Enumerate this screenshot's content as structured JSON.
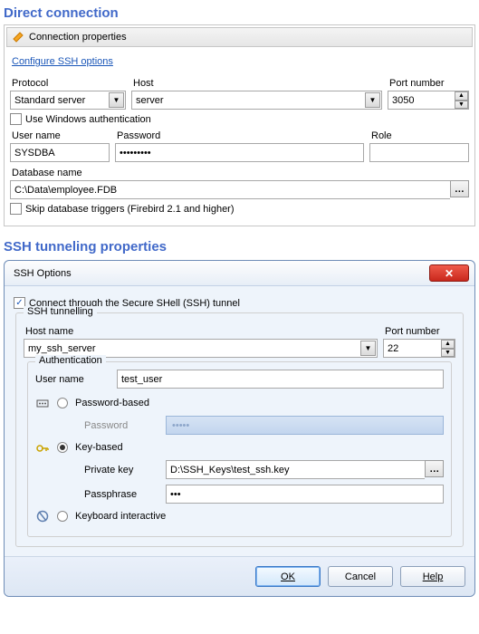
{
  "direct": {
    "title": "Direct connection",
    "toolbar_label": "Connection properties",
    "configure_link": "Configure SSH options",
    "fields": {
      "protocol": {
        "label": "Protocol",
        "value": "Standard server"
      },
      "host": {
        "label": "Host",
        "value": "server"
      },
      "port": {
        "label": "Port number",
        "value": "3050"
      },
      "win_auth": {
        "label": "Use Windows authentication",
        "checked": false
      },
      "user": {
        "label": "User name",
        "value": "SYSDBA"
      },
      "password": {
        "label": "Password",
        "value": "•••••••••"
      },
      "role": {
        "label": "Role",
        "value": ""
      },
      "database": {
        "label": "Database name",
        "value": "C:\\Data\\employee.FDB"
      },
      "skip_triggers": {
        "label": "Skip database triggers (Firebird 2.1 and higher)",
        "checked": false
      }
    }
  },
  "ssh": {
    "section_title": "SSH tunneling properties",
    "window_title": "SSH Options",
    "connect_check": {
      "label": "Connect through the Secure SHell (SSH) tunnel",
      "checked": true
    },
    "group_label": "SSH tunnelling",
    "host": {
      "label": "Host name",
      "value": "my_ssh_server"
    },
    "port": {
      "label": "Port number",
      "value": "22"
    },
    "auth": {
      "group_label": "Authentication",
      "user": {
        "label": "User name",
        "value": "test_user"
      },
      "mode": "key",
      "password": {
        "label": "Password-based",
        "field_label": "Password",
        "value": "•••••"
      },
      "key": {
        "label": "Key-based",
        "private_key_label": "Private key",
        "private_key_value": "D:\\SSH_Keys\\test_ssh.key",
        "passphrase_label": "Passphrase",
        "passphrase_value": "•••"
      },
      "keyboard": {
        "label": "Keyboard interactive"
      }
    },
    "buttons": {
      "ok": "OK",
      "cancel": "Cancel",
      "help": "Help"
    }
  }
}
